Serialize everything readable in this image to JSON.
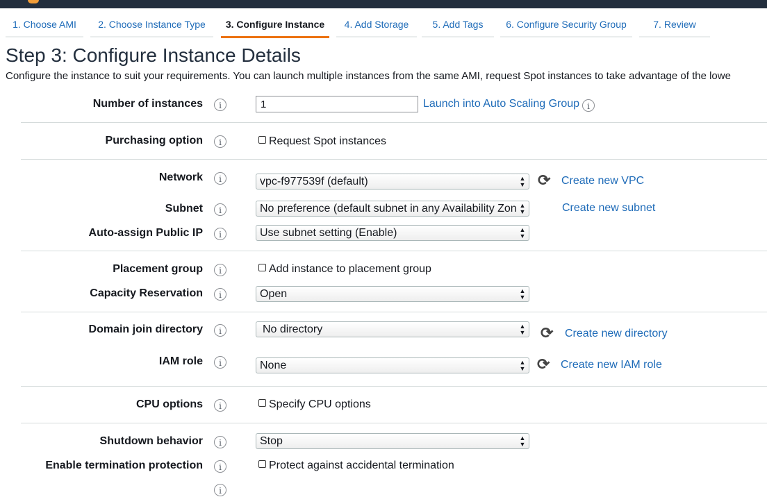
{
  "wizard": {
    "tabs": [
      {
        "label": "1. Choose AMI"
      },
      {
        "label": "2. Choose Instance Type"
      },
      {
        "label": "3. Configure Instance"
      },
      {
        "label": "4. Add Storage"
      },
      {
        "label": "5. Add Tags"
      },
      {
        "label": "6. Configure Security Group"
      },
      {
        "label": "7. Review"
      }
    ],
    "active_tab": 2
  },
  "page": {
    "title": "Step 3: Configure Instance Details",
    "description": "Configure the instance to suit your requirements. You can launch multiple instances from the same AMI, request Spot instances to take advantage of the lowe"
  },
  "info_icon_glyph": "i",
  "refresh_icon_glyph": "⟳",
  "select_arrows": "▲▼",
  "fields": {
    "number_of_instances": {
      "label": "Number of instances",
      "value": "1",
      "link": "Launch into Auto Scaling Group"
    },
    "purchasing_option": {
      "label": "Purchasing option",
      "checkbox": "Request Spot instances"
    },
    "network": {
      "label": "Network",
      "value": "vpc-f977539f (default)",
      "link": "Create new VPC"
    },
    "subnet": {
      "label": "Subnet",
      "value": "No preference (default subnet in any Availability Zon",
      "link": "Create new subnet"
    },
    "public_ip": {
      "label": "Auto-assign Public IP",
      "value": "Use subnet setting (Enable)"
    },
    "placement_group": {
      "label": "Placement group",
      "checkbox": "Add instance to placement group"
    },
    "capacity_reservation": {
      "label": "Capacity Reservation",
      "value": "Open"
    },
    "domain_join": {
      "label": "Domain join directory",
      "value": "No directory",
      "link": "Create new directory"
    },
    "iam_role": {
      "label": "IAM role",
      "value": "None",
      "link": "Create new IAM role"
    },
    "cpu_options": {
      "label": "CPU options",
      "checkbox": "Specify CPU options"
    },
    "shutdown_behavior": {
      "label": "Shutdown behavior",
      "value": "Stop"
    },
    "termination_protection": {
      "label": "Enable termination protection",
      "checkbox": "Protect against accidental termination"
    }
  },
  "colors": {
    "link": "#1e6bb8",
    "active_tab_underline": "#ec7211",
    "header_bar": "#232f3e"
  }
}
